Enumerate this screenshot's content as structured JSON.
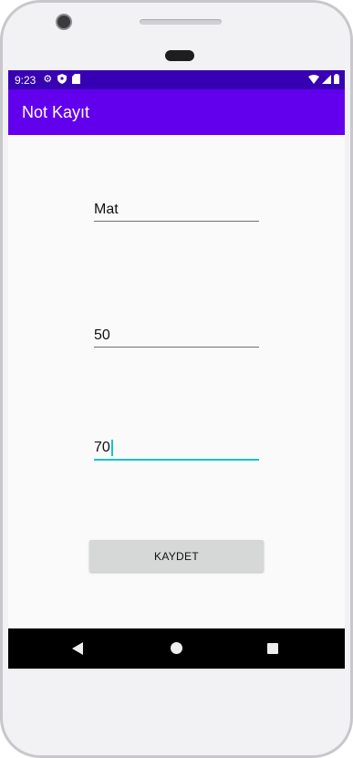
{
  "status_bar": {
    "time": "9:23"
  },
  "app_bar": {
    "title": "Not Kayıt"
  },
  "form": {
    "field_1_value": "Mat",
    "field_2_value": "50",
    "field_3_value": "70",
    "save_label": "KAYDET"
  },
  "colors": {
    "status_bar": "#3700b3",
    "app_bar": "#6200ee",
    "focus_accent": "#17c5c0",
    "button_bg": "#d6d7d7"
  },
  "icons": [
    "settings-icon",
    "shield-icon",
    "sd-card-icon",
    "wifi-icon",
    "signal-icon",
    "battery-icon",
    "back-icon",
    "home-icon",
    "recents-icon"
  ]
}
